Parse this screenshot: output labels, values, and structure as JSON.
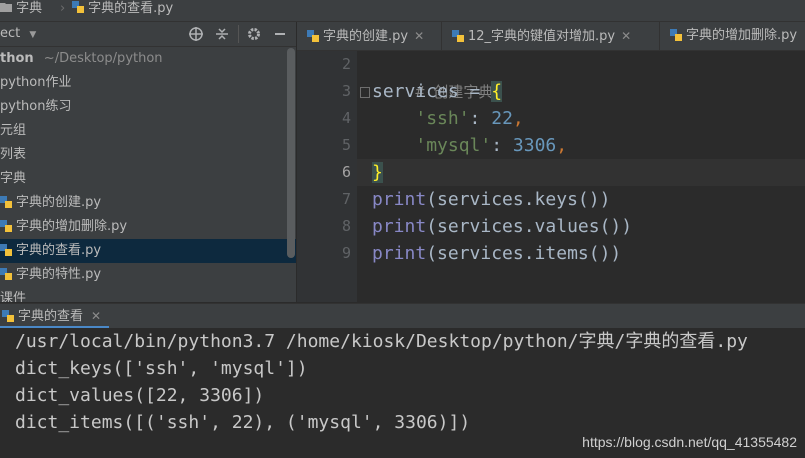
{
  "breadcrumb": {
    "items": [
      "字典",
      "字典的查看.py"
    ]
  },
  "project_panel": {
    "title": "ect",
    "root": {
      "name": "thon",
      "path": "~/Desktop/python"
    },
    "items": [
      {
        "label": "python作业",
        "type": "folder"
      },
      {
        "label": "python练习",
        "type": "folder"
      },
      {
        "label": "元组",
        "type": "folder"
      },
      {
        "label": "列表",
        "type": "folder"
      },
      {
        "label": "字典",
        "type": "folder"
      },
      {
        "label": "字典的创建.py",
        "type": "file"
      },
      {
        "label": "字典的增加删除.py",
        "type": "file"
      },
      {
        "label": "字典的查看.py",
        "type": "file",
        "selected": true
      },
      {
        "label": "字典的特性.py",
        "type": "file"
      },
      {
        "label": "课件",
        "type": "folder"
      }
    ]
  },
  "tabs": [
    {
      "label": "字典的创建.py"
    },
    {
      "label": "12_字典的键值对增加.py"
    },
    {
      "label": "字典的增加删除.py"
    }
  ],
  "editor": {
    "line_numbers": [
      "2",
      "3",
      "4",
      "5",
      "6",
      "7",
      "8",
      "9"
    ],
    "current_line": "6",
    "lines": {
      "l2": "# 创建字典",
      "l3_a": "services = ",
      "l3_b": "{",
      "l4_a": "    ",
      "l4_key": "'ssh'",
      "l4_colon": ": ",
      "l4_val": "22",
      "l4_comma": ",",
      "l5_a": "    ",
      "l5_key": "'mysql'",
      "l5_colon": ": ",
      "l5_val": "3306",
      "l5_comma": ",",
      "l6": "}",
      "l7_fn": "print",
      "l7_rest": "(services.keys())",
      "l8_fn": "print",
      "l8_rest": "(services.values())",
      "l9_fn": "print",
      "l9_rest": "(services.items())"
    }
  },
  "run": {
    "tab_label": "字典的查看",
    "output": [
      "/usr/local/bin/python3.7 /home/kiosk/Desktop/python/字典/字典的查看.py",
      "dict_keys(['ssh', 'mysql'])",
      "dict_values([22, 3306])",
      "dict_items([('ssh', 22), ('mysql', 3306)])"
    ]
  },
  "watermark": "https://blog.csdn.net/qq_41355482",
  "colors": {
    "accent_selection": "#0d293e",
    "string": "#6a8759",
    "number": "#6897bb",
    "builtin": "#8888c6",
    "brace_highlight": "#ffef28"
  },
  "icons": [
    "folder-icon",
    "python-file-icon",
    "dropdown-icon",
    "target-icon",
    "collapse-icon",
    "gear-icon",
    "hide-icon",
    "close-icon"
  ]
}
